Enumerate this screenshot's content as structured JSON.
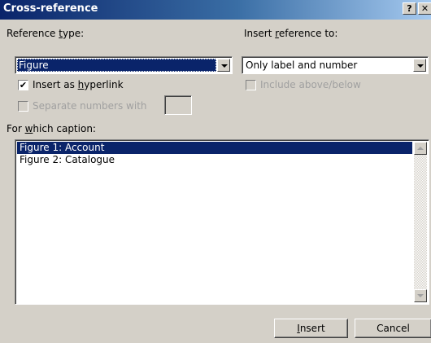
{
  "window": {
    "title": "Cross-reference",
    "help_label": "?",
    "close_label": "✕"
  },
  "reference_type": {
    "label_pre": "Reference ",
    "label_key": "t",
    "label_post": "ype:",
    "value": "Figure"
  },
  "insert_reference_to": {
    "label_pre": "Insert ",
    "label_key": "r",
    "label_post": "eference to:",
    "value": "Only label and number"
  },
  "insert_as_hyperlink": {
    "label_pre": "Insert as ",
    "label_key": "h",
    "label_post": "yperlink",
    "checked": true,
    "check_glyph": "✔"
  },
  "include_above_below": {
    "label": "Include above/below",
    "checked": false,
    "enabled": false
  },
  "separate_numbers": {
    "label": "Separate numbers with",
    "checked": false,
    "enabled": false,
    "value": ""
  },
  "caption": {
    "label_pre": "For ",
    "label_key": "w",
    "label_post": "hich caption:",
    "items": [
      "Figure 1: Account",
      "Figure 2: Catalogue"
    ],
    "selected_index": 0
  },
  "buttons": {
    "insert_key": "I",
    "insert_rest": "nsert",
    "cancel": "Cancel"
  }
}
